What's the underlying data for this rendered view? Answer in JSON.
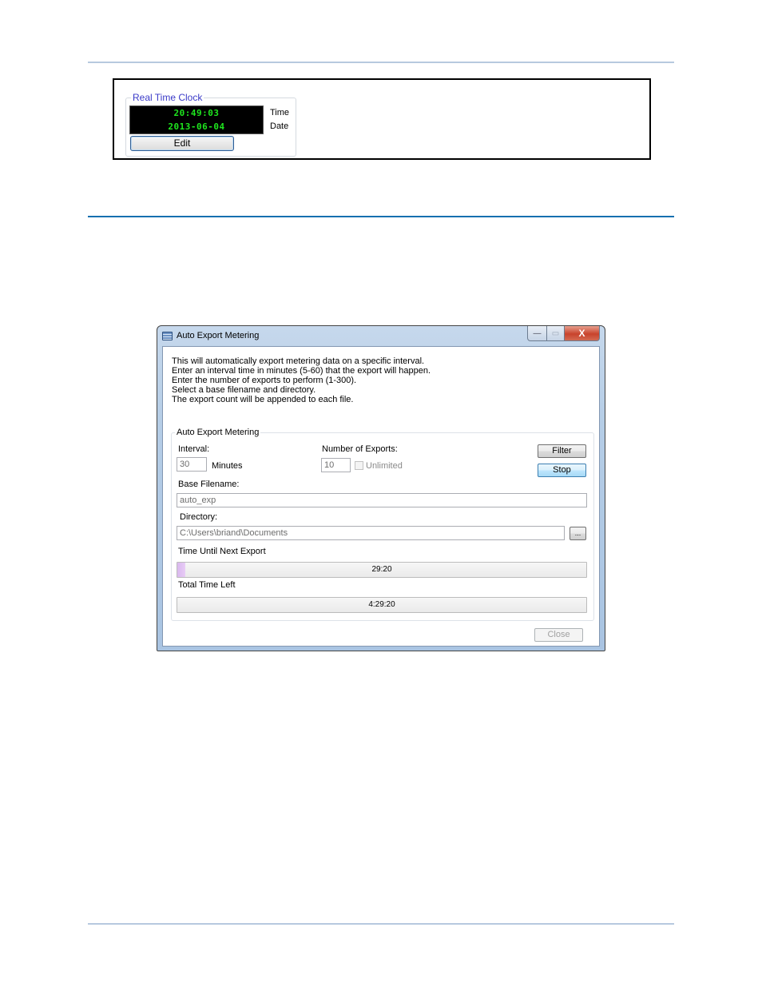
{
  "rtc": {
    "legend": "Real Time Clock",
    "time_value": "20:49:03",
    "date_value": "2013-06-04",
    "time_label": "Time",
    "date_label": "Date",
    "edit_label": "Edit"
  },
  "dialog": {
    "title": "Auto Export Metering",
    "controls": {
      "minimize": "—",
      "maximize": "▭",
      "close": "X"
    },
    "intro_lines": [
      "This will automatically export metering data on a specific interval.",
      "Enter an interval time in minutes (5-60) that the export will happen.",
      "Enter the number of exports to perform (1-300).",
      "Select a base filename and directory.",
      "The export count will be appended to each file."
    ],
    "group_legend": "Auto Export Metering",
    "interval": {
      "label": "Interval:",
      "value": "30",
      "unit": "Minutes"
    },
    "exports": {
      "label": "Number of Exports:",
      "value": "10",
      "unlimited_label": "Unlimited",
      "unlimited_checked": false
    },
    "filter_label": "Filter",
    "stop_label": "Stop",
    "base_filename": {
      "label": "Base Filename:",
      "value": "auto_exp"
    },
    "directory": {
      "label": "Directory:",
      "value": "C:\\Users\\briand\\Documents",
      "browse_label": "..."
    },
    "next_export": {
      "label": "Time Until Next Export",
      "text": "29:20",
      "progress_percent": 2
    },
    "total_left": {
      "label": "Total Time Left",
      "text": "4:29:20",
      "progress_percent": 0
    },
    "close_label": "Close"
  },
  "colors": {
    "rtc_digits": "#1ee61e",
    "rtc_legend": "#3a3ac8",
    "rule_top": "#b7c9df",
    "rule_mid": "#1670b0",
    "progress_fill": "#d9b8ee"
  }
}
